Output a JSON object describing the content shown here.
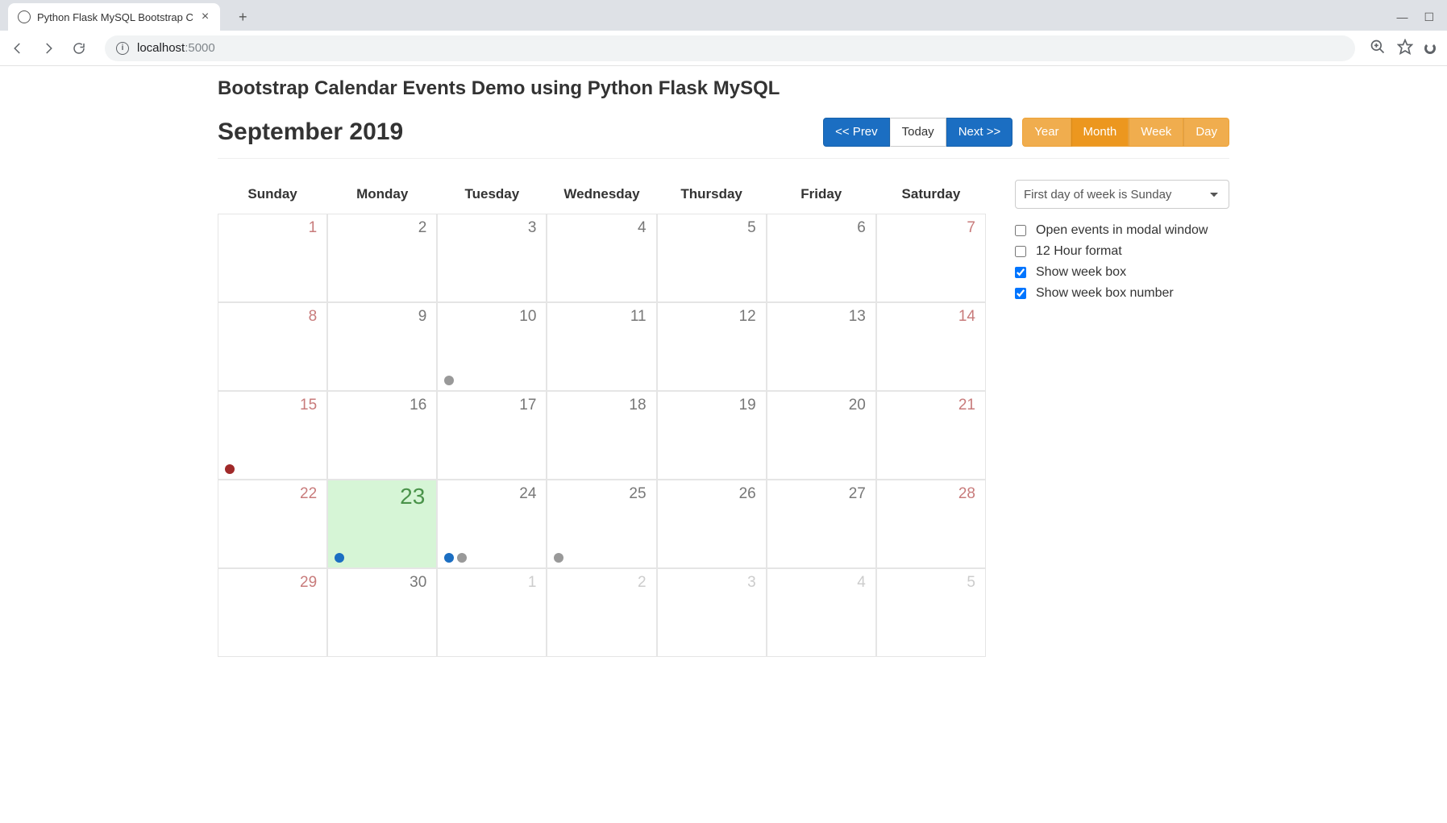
{
  "browser": {
    "tab_title": "Python Flask MySQL Bootstrap C",
    "url_host": "localhost",
    "url_port": ":5000"
  },
  "page_heading": "Bootstrap Calendar Events Demo using Python Flask MySQL",
  "month_label": "September 2019",
  "nav": {
    "prev": "<< Prev",
    "today": "Today",
    "next": "Next >>"
  },
  "views": {
    "year": "Year",
    "month": "Month",
    "week": "Week",
    "day": "Day"
  },
  "weekdays": [
    "Sunday",
    "Monday",
    "Tuesday",
    "Wednesday",
    "Thursday",
    "Friday",
    "Saturday"
  ],
  "weeks": [
    [
      {
        "n": "1",
        "cls": "sun",
        "ev": []
      },
      {
        "n": "2",
        "cls": "wkday",
        "ev": []
      },
      {
        "n": "3",
        "cls": "wkday",
        "ev": []
      },
      {
        "n": "4",
        "cls": "wkday",
        "ev": []
      },
      {
        "n": "5",
        "cls": "wkday",
        "ev": []
      },
      {
        "n": "6",
        "cls": "wkday",
        "ev": []
      },
      {
        "n": "7",
        "cls": "sat",
        "ev": []
      }
    ],
    [
      {
        "n": "8",
        "cls": "sun",
        "ev": []
      },
      {
        "n": "9",
        "cls": "wkday",
        "ev": []
      },
      {
        "n": "10",
        "cls": "wkday",
        "ev": [
          "grey"
        ]
      },
      {
        "n": "11",
        "cls": "wkday",
        "ev": []
      },
      {
        "n": "12",
        "cls": "wkday",
        "ev": []
      },
      {
        "n": "13",
        "cls": "wkday",
        "ev": []
      },
      {
        "n": "14",
        "cls": "sat",
        "ev": []
      }
    ],
    [
      {
        "n": "15",
        "cls": "sun",
        "ev": [
          "red"
        ]
      },
      {
        "n": "16",
        "cls": "wkday",
        "ev": []
      },
      {
        "n": "17",
        "cls": "wkday",
        "ev": []
      },
      {
        "n": "18",
        "cls": "wkday",
        "ev": []
      },
      {
        "n": "19",
        "cls": "wkday",
        "ev": []
      },
      {
        "n": "20",
        "cls": "wkday",
        "ev": []
      },
      {
        "n": "21",
        "cls": "sat",
        "ev": []
      }
    ],
    [
      {
        "n": "22",
        "cls": "sun",
        "ev": []
      },
      {
        "n": "23",
        "cls": "wkday",
        "today": true,
        "ev": [
          "blue"
        ]
      },
      {
        "n": "24",
        "cls": "wkday",
        "ev": [
          "blue",
          "grey"
        ]
      },
      {
        "n": "25",
        "cls": "wkday",
        "ev": [
          "grey"
        ]
      },
      {
        "n": "26",
        "cls": "wkday",
        "ev": []
      },
      {
        "n": "27",
        "cls": "wkday",
        "ev": []
      },
      {
        "n": "28",
        "cls": "sat",
        "ev": []
      }
    ],
    [
      {
        "n": "29",
        "cls": "sun",
        "ev": []
      },
      {
        "n": "30",
        "cls": "wkday",
        "ev": []
      },
      {
        "n": "1",
        "cls": "other",
        "ev": []
      },
      {
        "n": "2",
        "cls": "other",
        "ev": []
      },
      {
        "n": "3",
        "cls": "other",
        "ev": []
      },
      {
        "n": "4",
        "cls": "other",
        "ev": []
      },
      {
        "n": "5",
        "cls": "other",
        "ev": []
      }
    ]
  ],
  "side": {
    "first_day_option": "First day of week is Sunday",
    "opts": [
      {
        "label": "Open events in modal window",
        "checked": false
      },
      {
        "label": "12 Hour format",
        "checked": false
      },
      {
        "label": "Show week box",
        "checked": true
      },
      {
        "label": "Show week box number",
        "checked": true
      }
    ]
  }
}
